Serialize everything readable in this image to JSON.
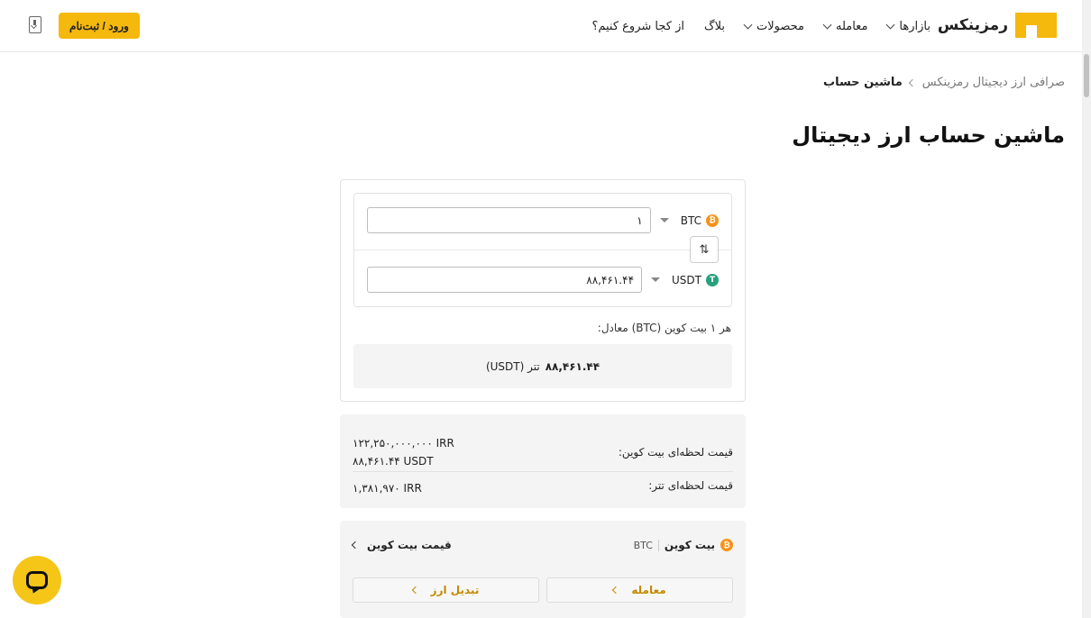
{
  "header": {
    "logo_text": "رمزینکس",
    "nav": [
      {
        "label": "بازارها",
        "has_dropdown": true
      },
      {
        "label": "معامله",
        "has_dropdown": true
      },
      {
        "label": "محصولات",
        "has_dropdown": true
      },
      {
        "label": "بلاگ",
        "has_dropdown": false
      },
      {
        "label": "از کجا شروع کنیم؟",
        "has_dropdown": false
      }
    ],
    "login_label": "ورود / ثبت‌نام",
    "brand_color": "#f5b80c"
  },
  "breadcrumb": {
    "parent": "صرافی ارز دیجیتال رمزینکس",
    "current": "ماشین حساب"
  },
  "page_title": "ماشین حساب ارز دیجیتال",
  "calculator": {
    "from": {
      "symbol": "BTC",
      "badge": "₿",
      "value": "۱"
    },
    "to": {
      "symbol": "USDT",
      "badge": "T",
      "value": "۸۸,۴۶۱.۴۴"
    },
    "swap_icon": "⇅",
    "equiv_label": "هر ۱ بیت کوین (BTC) معادل:",
    "result_value": "۸۸,۴۶۱.۴۴",
    "result_unit": "تتر (USDT)"
  },
  "prices": {
    "btc_label": "قیمت لحظه‌ای بیت کوین:",
    "btc_irr": "۱۲۲,۲۵۰,۰۰۰,۰۰۰ IRR",
    "btc_usdt": "۸۸,۴۶۱.۴۴ USDT",
    "usdt_label": "قیمت لحظه‌ای تتر:",
    "usdt_irr": "۱,۳۸۱,۹۷۰ IRR"
  },
  "links": {
    "coin_name": "بیت کوین",
    "coin_symbol": "BTC",
    "price_link": "قیمت بیت کوین",
    "trade_label": "معامله",
    "convert_label": "تبدیل ارز"
  }
}
